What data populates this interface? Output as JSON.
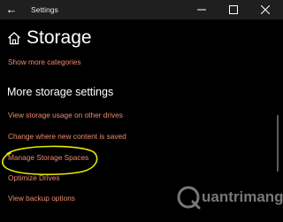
{
  "window": {
    "title": "Settings",
    "controls": {
      "minimize": "minimize-icon",
      "maximize": "maximize-icon",
      "close": "close-icon"
    }
  },
  "header": {
    "title": "Storage",
    "icon": "home-icon"
  },
  "top_links": {
    "show_more_categories": "Show more categories"
  },
  "more_storage": {
    "heading": "More storage settings",
    "links": [
      "View storage usage on other drives",
      "Change where new content is saved",
      "Manage Storage Spaces",
      "Optimize Drives",
      "View backup options"
    ]
  },
  "watermark": {
    "text": "uantrimang"
  },
  "colors": {
    "background": "#000000",
    "link": "#f08a6c",
    "annotation": "#e8e800",
    "titlebar": "#1f1f1f"
  }
}
